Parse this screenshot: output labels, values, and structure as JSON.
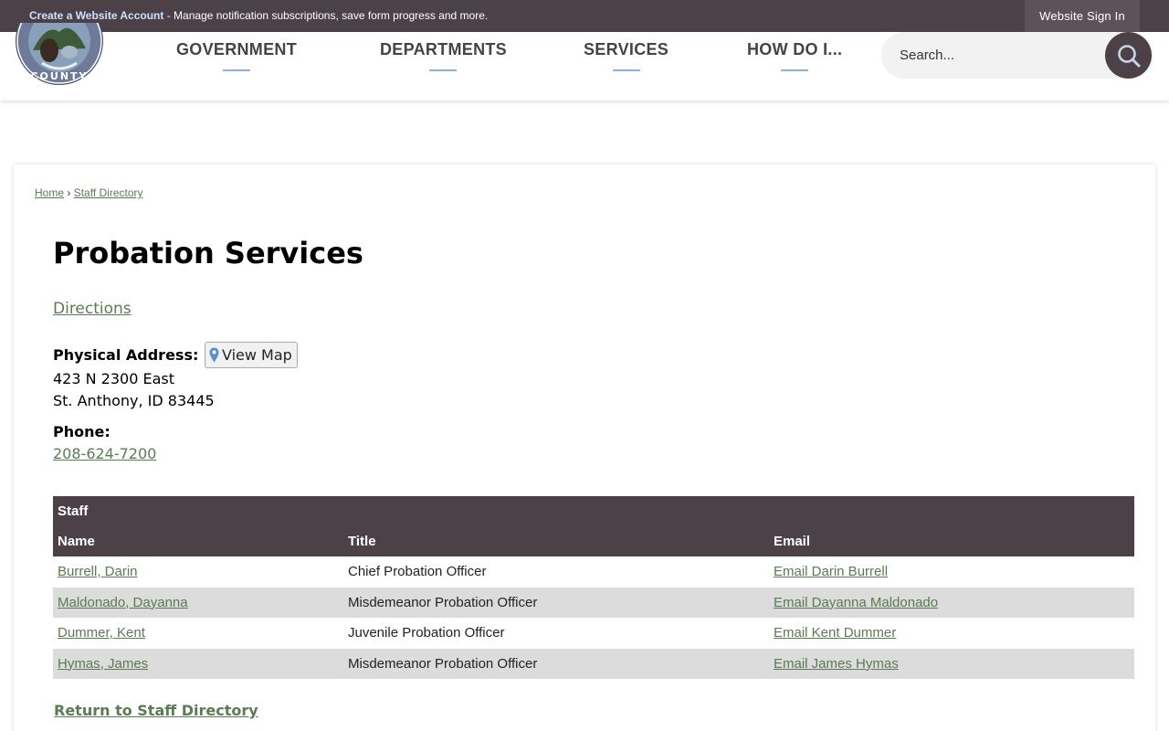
{
  "topbar": {
    "create_account_link": "Create a Website Account",
    "message": " - Manage notification subscriptions, save form progress and more.",
    "signin_label": "Website Sign In"
  },
  "header": {
    "logo_text": "COUNTY",
    "nav": [
      {
        "label": "GOVERNMENT"
      },
      {
        "label": "DEPARTMENTS"
      },
      {
        "label": "SERVICES"
      },
      {
        "label": "HOW DO I..."
      }
    ],
    "search": {
      "placeholder": "Search..."
    }
  },
  "breadcrumb": {
    "home": "Home",
    "separator": "›",
    "current": "Staff Directory"
  },
  "page": {
    "title": "Probation Services",
    "directions_link": "Directions",
    "address_label": "Physical Address:",
    "view_map_label": "View Map",
    "address_line1": "423 N 2300 East",
    "address_line2": "St. Anthony, ID 83445",
    "phone_label": "Phone:",
    "phone": "208-624-7200"
  },
  "staff": {
    "caption": "Staff",
    "columns": {
      "name": "Name",
      "title": "Title",
      "email": "Email"
    },
    "rows": [
      {
        "name": "Burrell, Darin",
        "title": "Chief Probation Officer",
        "email": "Email Darin Burrell"
      },
      {
        "name": "Maldonado, Dayanna",
        "title": "Misdemeanor Probation Officer",
        "email": "Email Dayanna Maldonado"
      },
      {
        "name": "Dummer, Kent",
        "title": "Juvenile Probation Officer",
        "email": "Email Kent Dummer"
      },
      {
        "name": "Hymas, James",
        "title": "Misdemeanor Probation Officer",
        "email": "Email James Hymas"
      }
    ]
  },
  "return_link": "Return to Staff Directory",
  "icons": {
    "search": "search-icon",
    "map_pin": "map-pin-icon"
  },
  "colors": {
    "topbar": "#4d4148",
    "link": "#5c7a53",
    "nav_underline": "#8fb0d8"
  }
}
